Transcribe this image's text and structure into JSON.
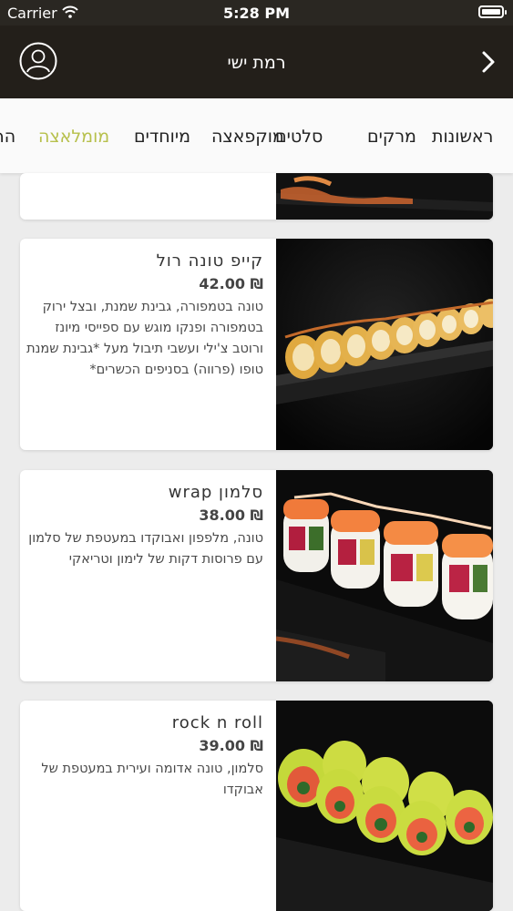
{
  "status_bar": {
    "carrier": "Carrier",
    "time": "5:28 PM"
  },
  "header": {
    "title": "רמת ישי",
    "left_icon": "user-circle-icon",
    "right_icon": "chevron-right-icon"
  },
  "tabs": {
    "items": [
      "ראשונות",
      "מרקים",
      "סלטים",
      "מוקפאצה",
      "מיוחדים",
      "מומלאצה",
      "הר"
    ],
    "active_label": "מומלאצה",
    "active_color": "#b7c04c"
  },
  "menu": {
    "items": [
      {
        "name": "קייפ טונה רול",
        "price": "₪ 42.00",
        "description": "טונה בטמפורה, גבינת שמנת, ובצל ירוק בטמפורה ופנקו מוגש עם ספייסי מיונז ורוטב צ'ילי ועשבי תיבול מעל *גבינת שמנת טופו (פרווה) בסניפים הכשרים*"
      },
      {
        "name": "סלמון wrap",
        "price": "₪ 38.00",
        "description": "טונה, מלפפון ואבוקדו במעטפת של סלמון עם פרוסות דקות של לימון וטריאקי"
      },
      {
        "name": "rock n roll",
        "price": "₪ 39.00",
        "description": "סלמון, טונה אדומה ועירית במעטפת של אבוקדו"
      }
    ]
  }
}
